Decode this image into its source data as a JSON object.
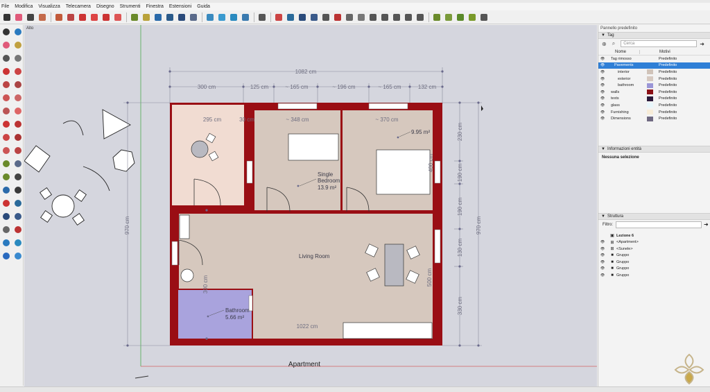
{
  "menu": [
    "File",
    "Modifica",
    "Visualizza",
    "Telecamera",
    "Disegno",
    "Strumenti",
    "Finestra",
    "Estensioni",
    "Guida"
  ],
  "viewport": {
    "scene_label": "Alto"
  },
  "drawing": {
    "overall_dim_top": "1082 cm",
    "top_segments": [
      "300 cm",
      "125 cm",
      "~ 165 cm",
      "~ 196 cm",
      "~ 165 cm",
      "132 cm"
    ],
    "inner_dims": {
      "room1_width": "295 cm",
      "room1_partial": "30 cm",
      "bedroom_width": "~ 348 cm",
      "bedroom2_width": "~ 370 cm",
      "bedroom2_height": "400 cm",
      "bathroom_height": "300 cm",
      "living_height": "500 cm",
      "bottom_width": "1022 cm"
    },
    "left_dim": "970 cm",
    "right_dims": [
      "230 cm",
      "190 cm",
      "190 cm",
      "130 cm",
      "330 cm"
    ],
    "right_total": "970 cm",
    "rooms": {
      "single_bedroom": [
        "Single",
        "Bedroom",
        "13.9 m²"
      ],
      "bedroom2_area": "9.95 m²",
      "living": "Living Room",
      "bathroom": [
        "Bathroom",
        "5.66 m²"
      ]
    },
    "component_label": "Apartment",
    "colors": {
      "walls": "#9a0e14",
      "interior": "#d6c8be",
      "exterior": "#f1dcd2",
      "bathroom": "#a9a3dd",
      "background": "#d5d6de"
    }
  },
  "panel": {
    "title": "Pannello predefinito",
    "tag_section": "Tag",
    "search_placeholder": "Cerca",
    "col_name": "Nome",
    "col_pattern": "Motivi",
    "tags": [
      {
        "name": "Tag rimosso",
        "value": "Predefinito",
        "color": "",
        "selected": false,
        "indent": 0
      },
      {
        "name": "Pavements",
        "value": "Predefinito",
        "color": "",
        "selected": true,
        "indent": 1
      },
      {
        "name": "interior",
        "value": "Predefinito",
        "color": "#d0c3b9",
        "selected": false,
        "indent": 2
      },
      {
        "name": "exterior",
        "value": "Predefinito",
        "color": "#d6c9c0",
        "selected": false,
        "indent": 2
      },
      {
        "name": "bathroom",
        "value": "Predefinito",
        "color": "#9a95d6",
        "selected": false,
        "indent": 2
      },
      {
        "name": "walls",
        "value": "Predefinito",
        "color": "#8b1016",
        "selected": false,
        "indent": 0
      },
      {
        "name": "texts",
        "value": "Predefinito",
        "color": "#2a1a3a",
        "selected": false,
        "indent": 0
      },
      {
        "name": "glass",
        "value": "Predefinito",
        "color": "#e8f6fb",
        "selected": false,
        "indent": 0
      },
      {
        "name": "Furnishing",
        "value": "Predefinito",
        "color": "#f7ecd8",
        "selected": false,
        "indent": 0
      },
      {
        "name": "Dimensions",
        "value": "Predefinito",
        "color": "#706a82",
        "selected": false,
        "indent": 0
      }
    ],
    "entity_section": "Informazioni entità",
    "entity_text": "Nessuna selezione",
    "outliner_section": "Struttura",
    "filter_label": "Filtro:",
    "outliner": [
      {
        "label": "Lezione 6",
        "glyph": "▣",
        "indent": 0,
        "bold": true
      },
      {
        "label": "<Apartment>",
        "glyph": "⊞",
        "indent": 1,
        "bold": false
      },
      {
        "label": "<Sunele>",
        "glyph": "⊞",
        "indent": 1,
        "bold": false
      },
      {
        "label": "Gruppo",
        "glyph": "■",
        "indent": 1,
        "bold": false
      },
      {
        "label": "Gruppo",
        "glyph": "■",
        "indent": 1,
        "bold": false
      },
      {
        "label": "Gruppo",
        "glyph": "■",
        "indent": 1,
        "bold": false
      },
      {
        "label": "Gruppo",
        "glyph": "■",
        "indent": 1,
        "bold": false
      }
    ]
  }
}
